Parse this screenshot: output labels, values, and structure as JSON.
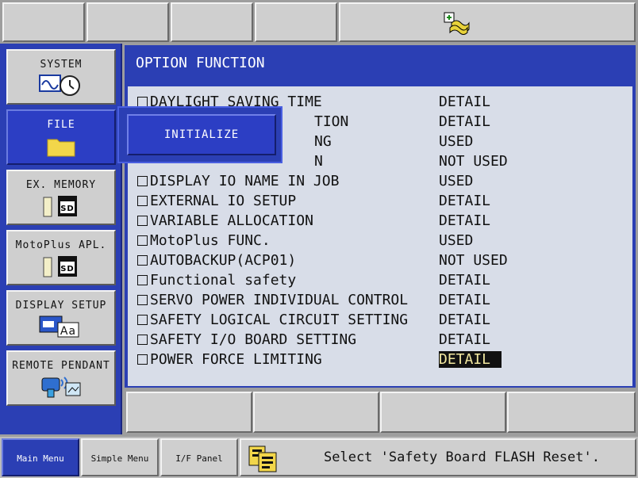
{
  "sidebar": {
    "items": [
      {
        "label": "SYSTEM",
        "icon": "system-clock-icon"
      },
      {
        "label": "FILE",
        "icon": "folder-icon",
        "active": true
      },
      {
        "label": "EX. MEMORY",
        "icon": "sd-card-icon"
      },
      {
        "label": "MotoPlus APL.",
        "icon": "sd-card-icon"
      },
      {
        "label": "DISPLAY SETUP",
        "icon": "display-font-icon"
      },
      {
        "label": "REMOTE PENDANT",
        "icon": "remote-pendant-icon"
      }
    ]
  },
  "submenu": {
    "initialize_label": "INITIALIZE"
  },
  "main": {
    "title": "OPTION FUNCTION",
    "rows": [
      {
        "name": "DAYLIGHT SAVING TIME",
        "value": "DETAIL"
      },
      {
        "name": "",
        "value": "DETAIL",
        "visible_fragment": "TION"
      },
      {
        "name": "",
        "value": "USED",
        "visible_fragment": "NG"
      },
      {
        "name": "",
        "value": "NOT USED",
        "visible_fragment": "N"
      },
      {
        "name": "DISPLAY IO NAME IN JOB",
        "value": "USED"
      },
      {
        "name": "EXTERNAL IO SETUP",
        "value": "DETAIL"
      },
      {
        "name": "VARIABLE ALLOCATION",
        "value": "DETAIL"
      },
      {
        "name": "MotoPlus FUNC.",
        "value": "USED"
      },
      {
        "name": "AUTOBACKUP(ACP01)",
        "value": "NOT USED"
      },
      {
        "name": "Functional safety",
        "value": "DETAIL"
      },
      {
        "name": "SERVO POWER INDIVIDUAL CONTROL",
        "value": "DETAIL"
      },
      {
        "name": "SAFETY LOGICAL CIRCUIT SETTING",
        "value": "DETAIL"
      },
      {
        "name": "SAFETY I/O BOARD SETTING",
        "value": "DETAIL"
      },
      {
        "name": "POWER FORCE LIMITING",
        "value": "DETAIL",
        "selected": true
      }
    ]
  },
  "statusbar": {
    "tabs": [
      "Main Menu",
      "Simple Menu",
      "I/F Panel"
    ],
    "message": "Select 'Safety Board FLASH Reset'."
  },
  "colors": {
    "accent": "#2b3fb4",
    "highlight_text": "#f2e8a0"
  }
}
